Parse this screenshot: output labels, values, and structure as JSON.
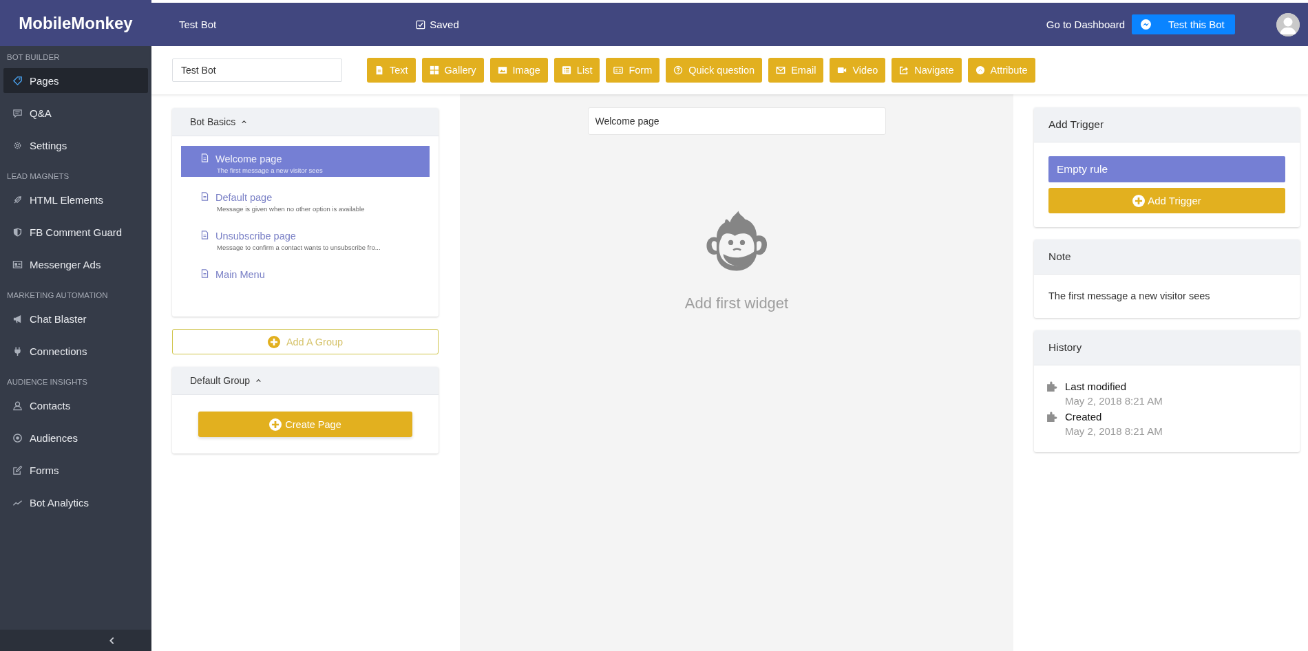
{
  "sidebar": {
    "logo": "MobileMonkey",
    "sections": [
      {
        "heading": "BOT BUILDER",
        "items": [
          {
            "label": "Pages",
            "selected": true
          },
          {
            "label": "Q&A",
            "selected": false
          },
          {
            "label": "Settings",
            "selected": false
          }
        ]
      },
      {
        "heading": "LEAD MAGNETS",
        "items": [
          {
            "label": "HTML Elements",
            "selected": false
          },
          {
            "label": "FB Comment Guard",
            "selected": false
          },
          {
            "label": "Messenger Ads",
            "selected": false
          }
        ]
      },
      {
        "heading": "MARKETING AUTOMATION",
        "items": [
          {
            "label": "Chat Blaster",
            "selected": false
          },
          {
            "label": "Connections",
            "selected": false
          }
        ]
      },
      {
        "heading": "AUDIENCE INSIGHTS",
        "items": [
          {
            "label": "Contacts",
            "selected": false
          },
          {
            "label": "Audiences",
            "selected": false
          },
          {
            "label": "Forms",
            "selected": false
          },
          {
            "label": "Bot Analytics",
            "selected": false
          }
        ]
      }
    ]
  },
  "header": {
    "bot_name": "Test Bot",
    "status": "Saved",
    "dashboard_link": "Go to Dashboard",
    "test_button": "Test this Bot"
  },
  "toolbar": {
    "name_value": "Test Bot",
    "widgets": [
      "Text",
      "Gallery",
      "Image",
      "List",
      "Form",
      "Quick question",
      "Email",
      "Video",
      "Navigate",
      "Attribute"
    ]
  },
  "groups": [
    {
      "title": "Bot Basics",
      "expanded": true,
      "pages": [
        {
          "title": "Welcome page",
          "description": "The first message a new visitor sees",
          "selected": true
        },
        {
          "title": "Default page",
          "description": "Message is given when no other option is available",
          "selected": false
        },
        {
          "title": "Unsubscribe page",
          "description": "Message to confirm a contact wants to unsubscribe fro...",
          "selected": false
        },
        {
          "title": "Main Menu",
          "selected": false
        }
      ]
    },
    {
      "title": "Default Group",
      "expanded": true,
      "create_button": "Create Page"
    }
  ],
  "add_group_button": "Add A Group",
  "canvas": {
    "page_title_value": "Welcome page",
    "empty_message": "Add first widget"
  },
  "right_panel": {
    "trigger": {
      "title": "Add Trigger",
      "rules": [
        "Empty rule"
      ],
      "add_button": "Add Trigger"
    },
    "note": {
      "title": "Note",
      "text": "The first message a new visitor sees"
    },
    "history": {
      "title": "History",
      "events": [
        {
          "label": "Last modified",
          "time": "May 2, 2018 8:21 AM"
        },
        {
          "label": "Created",
          "time": "May 2, 2018 8:21 AM"
        }
      ]
    }
  }
}
